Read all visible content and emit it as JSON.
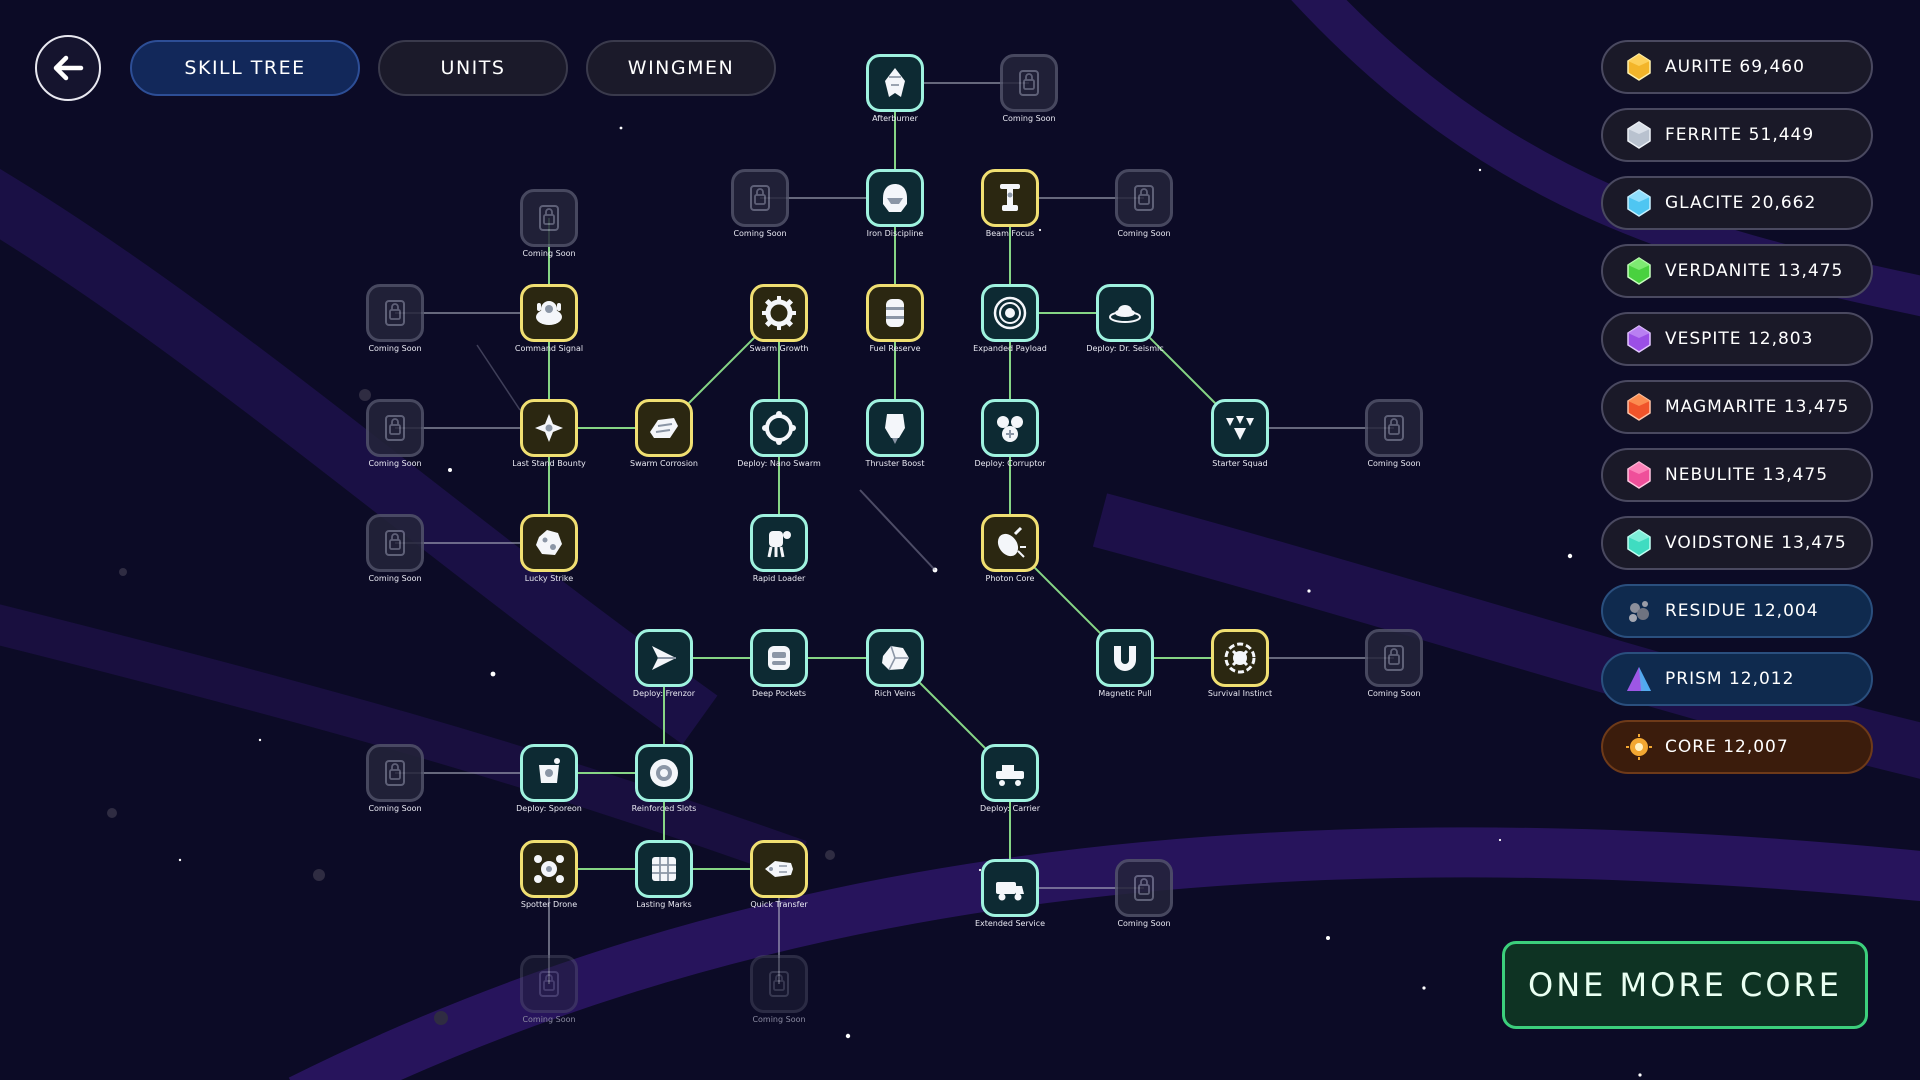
{
  "nav": {
    "back_icon": "arrow-left-icon",
    "tabs": [
      {
        "label": "SKILL TREE",
        "active": true
      },
      {
        "label": "UNITS",
        "active": false
      },
      {
        "label": "WINGMEN",
        "active": false
      }
    ]
  },
  "colors": {
    "background": "#0c0b26",
    "node_unlocked_border": "#9ff2df",
    "node_gold_border": "#f0df72",
    "node_locked_border": "#52536a",
    "link_green": "#8de08a",
    "link_locked": "#b9bccb",
    "button_green": "#3ccf7c",
    "active_tab": "#12285a"
  },
  "skill_tree": {
    "nodes": [
      {
        "id": "afterburner",
        "label": "Afterburner",
        "state": "unlocked",
        "icon": "afterburner-icon"
      },
      {
        "id": "cs_top",
        "label": "Coming Soon",
        "state": "locked",
        "icon": "lock-icon"
      },
      {
        "id": "cs_a",
        "label": "Coming Soon",
        "state": "locked",
        "icon": "lock-icon"
      },
      {
        "id": "iron_discipline",
        "label": "Iron Discipline",
        "state": "unlocked",
        "icon": "helmet-icon"
      },
      {
        "id": "beam_focus",
        "label": "Beam Focus",
        "state": "gold",
        "icon": "beam-tower-icon"
      },
      {
        "id": "cs_b",
        "label": "Coming Soon",
        "state": "locked",
        "icon": "lock-icon"
      },
      {
        "id": "cs_c",
        "label": "Coming Soon",
        "state": "locked",
        "icon": "lock-icon"
      },
      {
        "id": "command_signal",
        "label": "Command Signal",
        "state": "gold",
        "icon": "command-pod-icon"
      },
      {
        "id": "cs_d",
        "label": "Coming Soon",
        "state": "locked",
        "icon": "lock-icon"
      },
      {
        "id": "swarm_growth",
        "label": "Swarm Growth",
        "state": "gold",
        "icon": "gear-ring-icon"
      },
      {
        "id": "fuel_reserve",
        "label": "Fuel Reserve",
        "state": "gold",
        "icon": "fuel-barrel-icon"
      },
      {
        "id": "expanded_payload",
        "label": "Expanded Payload",
        "state": "unlocked",
        "icon": "radial-burst-icon"
      },
      {
        "id": "deploy_dr_seismic",
        "label": "Deploy: Dr. Seismic",
        "state": "unlocked",
        "icon": "seismic-ufo-icon"
      },
      {
        "id": "cs_e",
        "label": "Coming Soon",
        "state": "locked",
        "icon": "lock-icon"
      },
      {
        "id": "last_stand_bounty",
        "label": "Last Stand Bounty",
        "state": "gold",
        "icon": "bounty-ship-icon"
      },
      {
        "id": "swarm_corrosion",
        "label": "Swarm Corrosion",
        "state": "gold",
        "icon": "corrosion-ship-icon"
      },
      {
        "id": "deploy_nano_swarm",
        "label": "Deploy: Nano Swarm",
        "state": "unlocked",
        "icon": "nano-ring-icon"
      },
      {
        "id": "thruster_boost",
        "label": "Thruster Boost",
        "state": "unlocked",
        "icon": "thruster-icon"
      },
      {
        "id": "deploy_corruptor",
        "label": "Deploy: Corruptor",
        "state": "unlocked",
        "icon": "corruptor-icon"
      },
      {
        "id": "starter_squad",
        "label": "Starter Squad",
        "state": "unlocked",
        "icon": "squad-icon"
      },
      {
        "id": "cs_f",
        "label": "Coming Soon",
        "state": "locked",
        "icon": "lock-icon"
      },
      {
        "id": "cs_g",
        "label": "Coming Soon",
        "state": "locked",
        "icon": "lock-icon"
      },
      {
        "id": "lucky_strike",
        "label": "Lucky Strike",
        "state": "gold",
        "icon": "asteroid-icon"
      },
      {
        "id": "rapid_loader",
        "label": "Rapid Loader",
        "state": "unlocked",
        "icon": "rapid-loader-icon"
      },
      {
        "id": "photon_core",
        "label": "Photon Core",
        "state": "gold",
        "icon": "bomb-icon"
      },
      {
        "id": "deploy_frenzor",
        "label": "Deploy: Frenzor",
        "state": "unlocked",
        "icon": "frenzor-icon"
      },
      {
        "id": "deep_pockets",
        "label": "Deep Pockets",
        "state": "unlocked",
        "icon": "storage-pod-icon"
      },
      {
        "id": "rich_veins",
        "label": "Rich Veins",
        "state": "unlocked",
        "icon": "ore-chunk-icon"
      },
      {
        "id": "magnetic_pull",
        "label": "Magnetic Pull",
        "state": "unlocked",
        "icon": "magnet-icon"
      },
      {
        "id": "survival_instinct",
        "label": "Survival Instinct",
        "state": "gold",
        "icon": "survival-emblem-icon"
      },
      {
        "id": "cs_h",
        "label": "Coming Soon",
        "state": "locked",
        "icon": "lock-icon"
      },
      {
        "id": "cs_i",
        "label": "Coming Soon",
        "state": "locked",
        "icon": "lock-icon"
      },
      {
        "id": "deploy_sporeon",
        "label": "Deploy: Sporeon",
        "state": "unlocked",
        "icon": "sporeon-icon"
      },
      {
        "id": "reinforced_slots",
        "label": "Reinforced Slots",
        "state": "unlocked",
        "icon": "reinforced-slot-icon"
      },
      {
        "id": "deploy_carrier",
        "label": "Deploy: Carrier",
        "state": "unlocked",
        "icon": "carrier-icon"
      },
      {
        "id": "spotter_drone",
        "label": "Spotter Drone",
        "state": "gold",
        "icon": "drone-icon"
      },
      {
        "id": "lasting_marks",
        "label": "Lasting Marks",
        "state": "unlocked",
        "icon": "grid-crate-icon"
      },
      {
        "id": "quick_transfer",
        "label": "Quick Transfer",
        "state": "gold",
        "icon": "transfer-ship-icon"
      },
      {
        "id": "extended_service",
        "label": "Extended Service",
        "state": "unlocked",
        "icon": "service-truck-icon"
      },
      {
        "id": "cs_j",
        "label": "Coming Soon",
        "state": "locked",
        "icon": "lock-icon"
      },
      {
        "id": "cs_k",
        "label": "Coming Soon",
        "state": "locked_dim",
        "icon": "lock-icon"
      },
      {
        "id": "cs_l",
        "label": "Coming Soon",
        "state": "locked_dim",
        "icon": "lock-icon"
      }
    ],
    "links": [
      {
        "from": "afterburner",
        "to": "cs_top",
        "type": "locked"
      },
      {
        "from": "afterburner",
        "to": "iron_discipline",
        "type": "green"
      },
      {
        "from": "cs_a",
        "to": "iron_discipline",
        "type": "locked"
      },
      {
        "from": "iron_discipline",
        "to": "fuel_reserve",
        "type": "green"
      },
      {
        "from": "beam_focus",
        "to": "cs_b",
        "type": "locked"
      },
      {
        "from": "beam_focus",
        "to": "expanded_payload",
        "type": "green"
      },
      {
        "from": "cs_c",
        "to": "command_signal",
        "type": "green"
      },
      {
        "from": "cs_d",
        "to": "command_signal",
        "type": "locked"
      },
      {
        "from": "command_signal",
        "to": "last_stand_bounty",
        "type": "green"
      },
      {
        "from": "cs_e",
        "to": "last_stand_bounty",
        "type": "locked"
      },
      {
        "from": "last_stand_bounty",
        "to": "swarm_corrosion",
        "type": "green"
      },
      {
        "from": "last_stand_bounty",
        "to": "lucky_strike",
        "type": "green"
      },
      {
        "from": "swarm_corrosion",
        "to": "swarm_growth",
        "type": "green"
      },
      {
        "from": "swarm_growth",
        "to": "deploy_nano_swarm",
        "type": "green"
      },
      {
        "from": "deploy_nano_swarm",
        "to": "rapid_loader",
        "type": "green"
      },
      {
        "from": "fuel_reserve",
        "to": "thruster_boost",
        "type": "green"
      },
      {
        "from": "expanded_payload",
        "to": "deploy_dr_seismic",
        "type": "green"
      },
      {
        "from": "expanded_payload",
        "to": "deploy_corruptor",
        "type": "green"
      },
      {
        "from": "deploy_dr_seismic",
        "to": "starter_squad",
        "type": "green"
      },
      {
        "from": "starter_squad",
        "to": "cs_f",
        "type": "locked"
      },
      {
        "from": "deploy_corruptor",
        "to": "photon_core",
        "type": "green"
      },
      {
        "from": "cs_g",
        "to": "lucky_strike",
        "type": "locked"
      },
      {
        "from": "photon_core",
        "to": "magnetic_pull",
        "type": "green"
      },
      {
        "from": "magnetic_pull",
        "to": "survival_instinct",
        "type": "green"
      },
      {
        "from": "survival_instinct",
        "to": "cs_h",
        "type": "locked"
      },
      {
        "from": "deploy_frenzor",
        "to": "deep_pockets",
        "type": "green"
      },
      {
        "from": "deep_pockets",
        "to": "rich_veins",
        "type": "green"
      },
      {
        "from": "rich_veins",
        "to": "deploy_carrier",
        "type": "green"
      },
      {
        "from": "deploy_frenzor",
        "to": "reinforced_slots",
        "type": "green"
      },
      {
        "from": "cs_i",
        "to": "deploy_sporeon",
        "type": "locked"
      },
      {
        "from": "deploy_sporeon",
        "to": "reinforced_slots",
        "type": "green"
      },
      {
        "from": "reinforced_slots",
        "to": "lasting_marks",
        "type": "green"
      },
      {
        "from": "spotter_drone",
        "to": "lasting_marks",
        "type": "green"
      },
      {
        "from": "lasting_marks",
        "to": "quick_transfer",
        "type": "green"
      },
      {
        "from": "deploy_carrier",
        "to": "extended_service",
        "type": "green"
      },
      {
        "from": "extended_service",
        "to": "cs_j",
        "type": "locked"
      },
      {
        "from": "spotter_drone",
        "to": "cs_k",
        "type": "locked"
      },
      {
        "from": "quick_transfer",
        "to": "cs_l",
        "type": "locked"
      }
    ]
  },
  "resources": [
    {
      "name": "AURITE",
      "amount": "69,460",
      "label": "AURITE 69,460",
      "color": "#f3b52a",
      "bg": "#1a1928",
      "border": "#4a4960"
    },
    {
      "name": "FERRITE",
      "amount": "51,449",
      "label": "FERRITE 51,449",
      "color": "#b9c2cf",
      "bg": "#1a1928",
      "border": "#4a4960"
    },
    {
      "name": "GLACITE",
      "amount": "20,662",
      "label": "GLACITE 20,662",
      "color": "#4fc6f2",
      "bg": "#1a1928",
      "border": "#4a4960"
    },
    {
      "name": "VERDANITE",
      "amount": "13,475",
      "label": "VERDANITE 13,475",
      "color": "#49d13f",
      "bg": "#1a1928",
      "border": "#4a4960"
    },
    {
      "name": "VESPITE",
      "amount": "12,803",
      "label": "VESPITE 12,803",
      "color": "#9b4fe6",
      "bg": "#1a1928",
      "border": "#4a4960"
    },
    {
      "name": "MAGMARITE",
      "amount": "13,475",
      "label": "MAGMARITE 13,475",
      "color": "#f0542a",
      "bg": "#1a1928",
      "border": "#4a4960"
    },
    {
      "name": "NEBULITE",
      "amount": "13,475",
      "label": "NEBULITE 13,475",
      "color": "#ef4f9a",
      "bg": "#1a1928",
      "border": "#4a4960"
    },
    {
      "name": "VOIDSTONE",
      "amount": "13,475",
      "label": "VOIDSTONE 13,475",
      "color": "#3fdcc1",
      "bg": "#1a1928",
      "border": "#4a4960"
    },
    {
      "name": "RESIDUE",
      "amount": "12,004",
      "label": "RESIDUE 12,004",
      "color": "#8c8f9b",
      "bg": "#0f2a4e",
      "border": "#2a4f7e"
    },
    {
      "name": "PRISM",
      "amount": "12,012",
      "label": "PRISM 12,012",
      "color": "#6e6cf0",
      "bg": "#0f2a4e",
      "border": "#2a4f7e"
    },
    {
      "name": "CORE",
      "amount": "12,007",
      "label": "CORE 12,007",
      "color": "#f2a732",
      "bg": "#3b1c0c",
      "border": "#6e3a19"
    }
  ],
  "action_button": {
    "label": "ONE MORE CORE"
  }
}
